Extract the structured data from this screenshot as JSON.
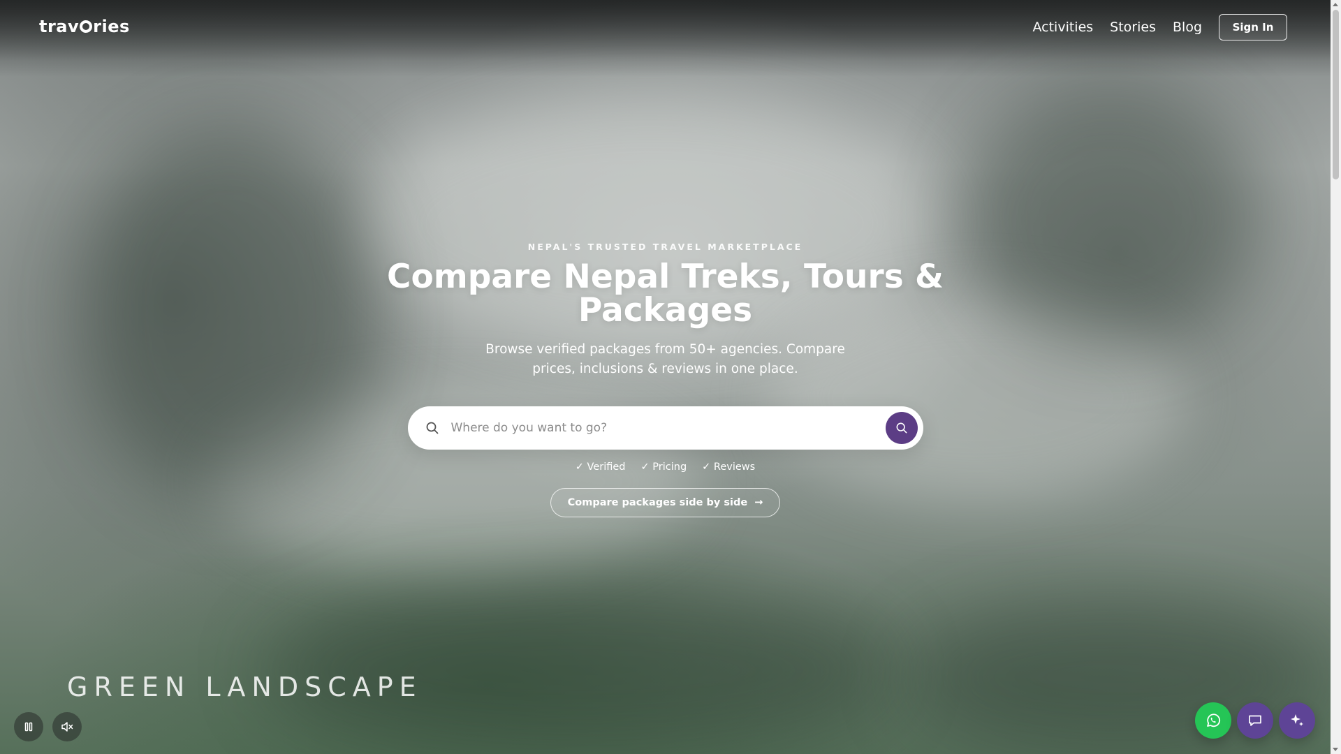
{
  "header": {
    "logo_text_start": "trav",
    "logo_text_end": "ries",
    "nav": [
      "Activities",
      "Stories",
      "Blog"
    ],
    "signin_label": "Sign In"
  },
  "hero": {
    "eyebrow": "NEPAL'S TRUSTED TRAVEL MARKETPLACE",
    "title": "Compare Nepal Treks, Tours & Packages",
    "subtitle": "Browse verified packages from 50+ agencies. Compare prices, inclusions & reviews in one place.",
    "search": {
      "placeholder": "Where do you want to go?",
      "value": ""
    },
    "checks": [
      "✓ Verified",
      "✓ Pricing",
      "✓ Reviews"
    ],
    "compare_label": "Compare packages side by side",
    "compare_arrow": "→"
  },
  "video": {
    "caption": "GREEN LANDSCAPE",
    "controls": {
      "pause_icon": "pause-icon",
      "mute_icon": "muted-speaker-icon"
    }
  },
  "fabs": [
    {
      "icon": "whatsapp-icon",
      "color": "#25c556"
    },
    {
      "icon": "chat-bubble-icon",
      "color": "#5e4496"
    },
    {
      "icon": "sparkle-icon",
      "color": "#5e4496"
    }
  ],
  "colors": {
    "accent": "#5c3d85",
    "whatsapp": "#25c556",
    "white": "#ffffff"
  }
}
